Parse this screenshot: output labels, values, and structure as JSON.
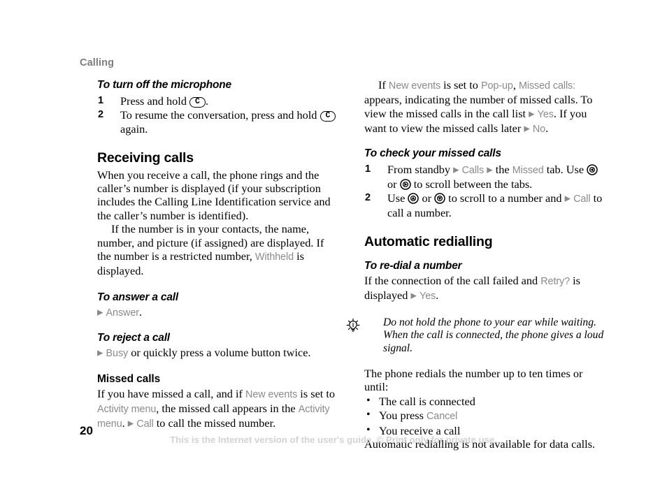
{
  "page": {
    "running_head": "Calling",
    "folio": "20",
    "footer_note": "This is the Internet version of the user's guide. © Print only for private use."
  },
  "icons": {
    "key_clear": "C",
    "nav_left": "nav-key-left-icon",
    "nav_right": "nav-key-right-icon",
    "nav_up": "nav-key-up-icon",
    "nav_down": "nav-key-down-icon",
    "tip_bulb": "lightbulb-tip-icon",
    "arrow_marker": "▶",
    "bullet_marker": "•"
  },
  "colors": {
    "ui_term": "#8a8a8a",
    "running_head": "#7d7d7d",
    "footer_note": "#d3d3d3",
    "body_text": "#000000"
  },
  "left_column": {
    "proc_microphone": {
      "heading": "To turn off the microphone",
      "steps": [
        {
          "num": "1",
          "parts": [
            {
              "t": "text",
              "v": "Press and hold "
            },
            {
              "t": "key",
              "v": "C"
            },
            {
              "t": "text",
              "v": "."
            }
          ]
        },
        {
          "num": "2",
          "parts": [
            {
              "t": "text",
              "v": "To resume the conversation, press and hold "
            },
            {
              "t": "key",
              "v": "C"
            },
            {
              "t": "text",
              "v": " again."
            }
          ]
        }
      ]
    },
    "section_receiving": {
      "heading": "Receiving calls",
      "para_1": "When you receive a call, the phone rings and the caller’s number is displayed (if your subscription includes the Calling Line Identification service and the caller’s number is identified).",
      "para_2_a": "If the number is in your contacts, the name, number, and picture (if assigned) are displayed. If the number is a restricted number, ",
      "para_2_ui": "Withheld",
      "para_2_b": " is displayed."
    },
    "proc_answer": {
      "heading": "To answer a call",
      "action_ui": "Answer",
      "action_tail": "."
    },
    "proc_reject": {
      "heading": "To reject a call",
      "action_ui": "Busy",
      "action_tail": " or quickly press a volume button twice."
    },
    "sub_missed": {
      "heading": "Missed calls",
      "para_a": "If you have missed a call, and if ",
      "para_ui_1": "New events",
      "para_b": " is set to ",
      "para_ui_2": "Activity menu",
      "para_c": ", the missed call appears in the ",
      "para_ui_3": "Activity menu",
      "para_d": ". ",
      "para_ui_4": "Call",
      "para_e": " to call the missed number."
    }
  },
  "right_column": {
    "para_popup": {
      "a": "If ",
      "ui_1": "New events",
      "b": " is set to ",
      "ui_2": "Pop-up",
      "c": ", ",
      "ui_3": "Missed calls:",
      "d": " appears, indicating the number of missed calls. To view the missed calls in the call list ",
      "ui_4": "Yes",
      "e": ". If you want to view the missed calls later ",
      "ui_5": "No",
      "f": "."
    },
    "proc_check_missed": {
      "heading": "To check your missed calls",
      "steps": [
        {
          "num": "1",
          "parts": [
            {
              "t": "text",
              "v": "From standby "
            },
            {
              "t": "arrow",
              "v": "▶"
            },
            {
              "t": "ui",
              "v": "Calls"
            },
            {
              "t": "arrow",
              "v": "▶"
            },
            {
              "t": "text",
              "v": " the "
            },
            {
              "t": "ui",
              "v": "Missed"
            },
            {
              "t": "text",
              "v": " tab. Use "
            },
            {
              "t": "nav",
              "v": "left"
            },
            {
              "t": "text",
              "v": " or "
            },
            {
              "t": "nav",
              "v": "right"
            },
            {
              "t": "text",
              "v": " to scroll between the tabs."
            }
          ]
        },
        {
          "num": "2",
          "parts": [
            {
              "t": "text",
              "v": "Use "
            },
            {
              "t": "nav",
              "v": "up"
            },
            {
              "t": "text",
              "v": " or "
            },
            {
              "t": "nav",
              "v": "down"
            },
            {
              "t": "text",
              "v": " to scroll to a number and "
            },
            {
              "t": "arrow",
              "v": "▶"
            },
            {
              "t": "ui",
              "v": "Call"
            },
            {
              "t": "text",
              "v": " to call a number."
            }
          ]
        }
      ]
    },
    "section_redial": {
      "heading": "Automatic redialling",
      "proc_redial": {
        "heading": "To re-dial a number",
        "para_a": "If the connection of the call failed and ",
        "para_ui_1": "Retry?",
        "para_b": " is displayed ",
        "para_ui_2": "Yes",
        "para_c": "."
      },
      "tip": "Do not hold the phone to your ear while waiting. When the call is connected, the phone gives a loud signal.",
      "para_redials": "The phone redials the number up to ten times or until:",
      "bullets": [
        {
          "a": "The call is connected",
          "ui": "",
          "b": ""
        },
        {
          "a": "You press ",
          "ui": "Cancel",
          "b": ""
        },
        {
          "a": "You receive a call",
          "ui": "",
          "b": ""
        }
      ],
      "para_tail": "Automatic redialling is not available for data calls."
    }
  }
}
